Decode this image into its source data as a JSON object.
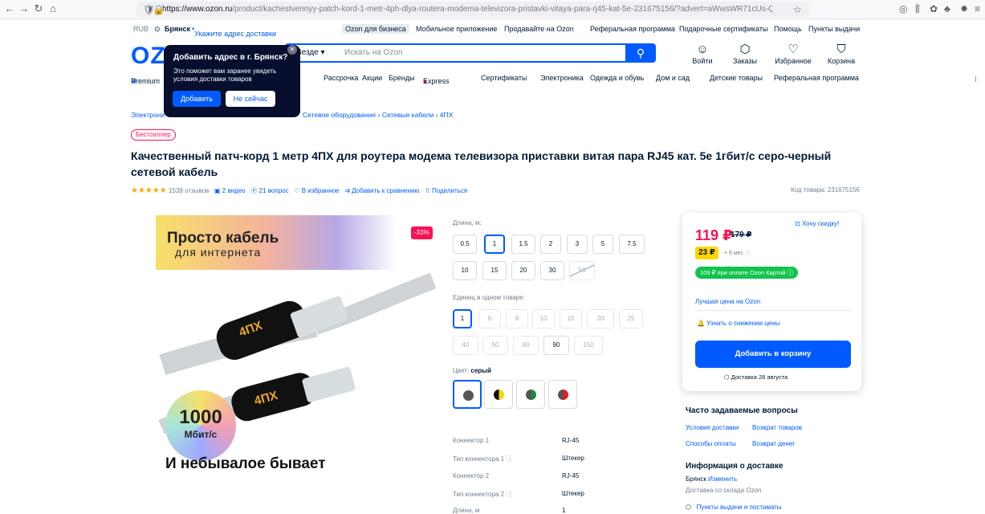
{
  "browser": {
    "url_domain": "https://www.ozon.ru",
    "url_path": "/product/kachestvennyy-patch-kord-1-metr-4ph-dlya-routera-modema-televizora-pristavki-vitaya-para-rj45-kat-5e-231675156/?advert=aWwsWR71cUs-QezCgIKaZUkiU"
  },
  "toplinks": {
    "currency": "RUB",
    "city": "Брянск",
    "address_link": "Укажите адрес доставки",
    "business": "Ozon для бизнеса",
    "items": [
      "Мобильное приложение",
      "Продавайте на Ozon",
      "Реферальная программа",
      "Подарочные сертификаты",
      "Помощь",
      "Пункты выдачи"
    ]
  },
  "header": {
    "logo": "OZON",
    "search_category": "Везде",
    "search_placeholder": "Искать на Ozon",
    "icons": [
      "Войти",
      "Заказы",
      "Избранное",
      "Корзина"
    ]
  },
  "nav": {
    "first": "Premium",
    "items": [
      "Рассрочка",
      "Акции",
      "Бренды",
      "Express",
      "Сертификаты",
      "Электроника",
      "Одежда и обувь",
      "Дом и сад",
      "Детские товары",
      "Реферальная программа"
    ]
  },
  "popover": {
    "title": "Добавить адрес в г. Брянск?",
    "desc": "Это поможет вам заранее увидеть условия доставки товаров",
    "add": "Добавить",
    "no": "Не сейчас"
  },
  "breadcrumb": {
    "first": "Электрони",
    "items": [
      "Сетевое оборудование",
      "Сетевые кабели",
      "4ПХ"
    ]
  },
  "product": {
    "badge": "Бестселлер",
    "title": "Качественный патч-корд 1 метр 4ПХ для роутера модема телевизора приставки витая пара RJ45 кат. 5e 1гбит/с серо-черный сетевой кабель",
    "stars": "★★★★★",
    "reviews": "1539 отзывов",
    "videos": "2 видео",
    "questions": "21 вопрос",
    "favorite": "В избранное",
    "compare": "Добавить к сравнению",
    "share": "Поделиться",
    "sku": "Код товара: 231675156",
    "discount": "-33%"
  },
  "image": {
    "promo_line1": "Просто кабель",
    "promo_line2": "для интернета",
    "speed_num": "1000",
    "speed_unit": "Мбит/с",
    "slogan": "И небывалое бывает",
    "plug_label": "4ПХ"
  },
  "options": {
    "length_label": "Длина, м:",
    "lengths_row1": [
      "0.5",
      "1",
      "1.5",
      "2",
      "3",
      "5",
      "7.5"
    ],
    "lengths_row2": [
      "10",
      "15",
      "20",
      "30",
      "50"
    ],
    "units_label": "Единиц в одном товаре:",
    "units_row1": [
      "1",
      "6",
      "8",
      "10",
      "15",
      "20",
      "25"
    ],
    "units_row2": [
      "40",
      "50",
      "60",
      "90",
      "150"
    ],
    "color_label": "Цвет:",
    "color_value": "серый"
  },
  "specs": [
    {
      "k": "Коннектор 1",
      "v": "RJ-45"
    },
    {
      "k": "Тип коннектора 1",
      "v": "Штекер"
    },
    {
      "k": "Коннектор 2",
      "v": "RJ-45"
    },
    {
      "k": "Тип коннектора 2",
      "v": "Штекер"
    },
    {
      "k": "Длина, м",
      "v": "1"
    }
  ],
  "buy": {
    "price": "119 ₽",
    "old_price": "179 ₽",
    "want_discount": "Хочу скидку!",
    "installment": "23 ₽",
    "installment_months": "× 6 мес",
    "card_price": "109 ₽ при оплате Ozon Картой",
    "best_price": "Лучшая цена на Ozon",
    "notify": "Узнать о снижении цены",
    "add_to_cart": "Добавить в корзину",
    "delivery": "Доставка 28 августа"
  },
  "faq": {
    "title": "Часто задаваемые вопросы",
    "l1": "Условия доставки",
    "l2": "Возврат товаров",
    "l3": "Способы оплаты",
    "l4": "Возврат денег"
  },
  "delivery_info": {
    "title": "Информация о доставке",
    "city": "Брянск",
    "change": "Изменить",
    "warehouse": "Доставка со склада Ozon",
    "pickup": "Пункты выдачи и постаматы"
  },
  "colors": {
    "brand": "#005bff",
    "price": "#f91155",
    "green": "#10c44c",
    "yellow": "#ffd600"
  }
}
